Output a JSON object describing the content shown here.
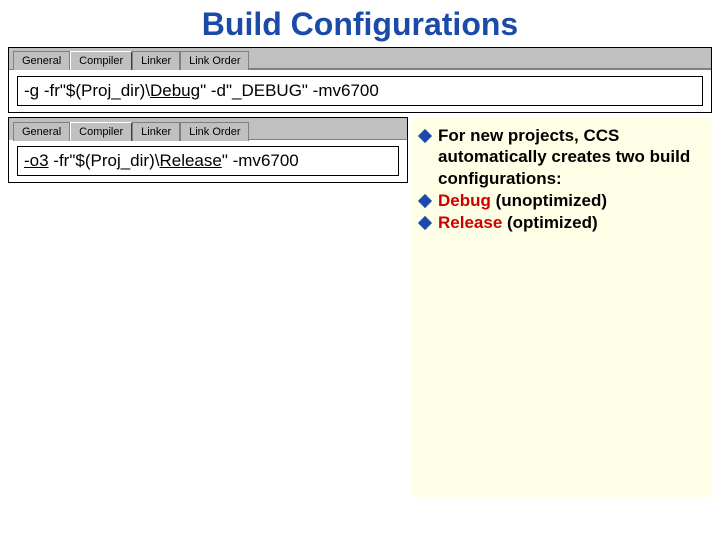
{
  "title": "Build Configurations",
  "box1": {
    "tabs": [
      "General",
      "Compiler",
      "Linker",
      "Link Order"
    ],
    "active_tab": 1,
    "field_pre": "-g -fr\"$(Proj_dir)\\",
    "field_u": "Debug",
    "field_mid": "\" -d\"_DEBUG\" -mv",
    "field_flag": "6700"
  },
  "box2": {
    "tabs": [
      "General",
      "Compiler",
      "Linker",
      "Link Order"
    ],
    "active_tab": 1,
    "field_opt": "-o3",
    "field_pre": " -fr\"$(Proj_dir)\\",
    "field_u": "Release",
    "field_mid": "\" -mv",
    "field_flag": "6700"
  },
  "bullets": {
    "b1_a": "For new projects, CCS automatically creates two build configurations:",
    "b2_a": "Debug",
    "b2_b": "  (unoptimized)",
    "b3_a": "Release",
    "b3_b": "    (optimized)"
  }
}
